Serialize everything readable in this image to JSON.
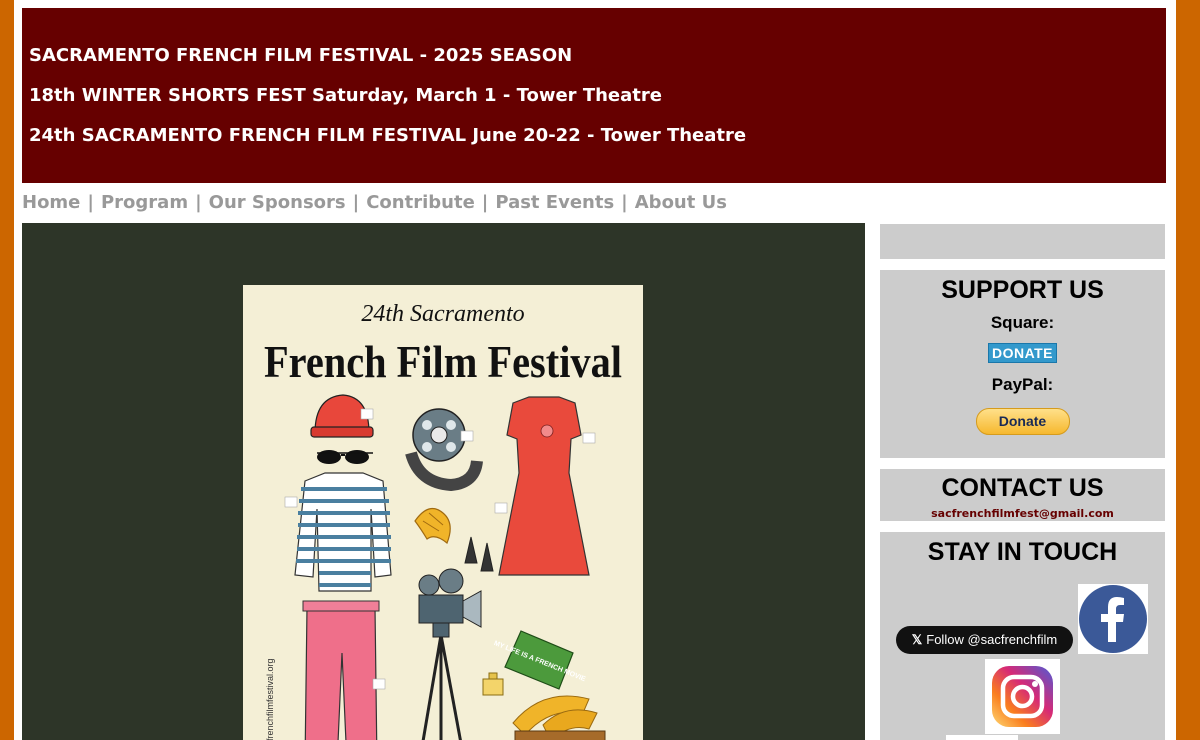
{
  "banner": {
    "line1": "SACRAMENTO FRENCH FILM FESTIVAL - 2025 SEASON",
    "line2": "18th WINTER SHORTS FEST Saturday, March 1 - Tower Theatre",
    "line3": "24th SACRAMENTO FRENCH FILM FESTIVAL June 20-22 - Tower Theatre"
  },
  "nav": {
    "items": [
      {
        "label": "Home"
      },
      {
        "label": "Program"
      },
      {
        "label": "Our Sponsors"
      },
      {
        "label": "Contribute"
      },
      {
        "label": "Past Events"
      },
      {
        "label": "About Us"
      }
    ],
    "separator": "|"
  },
  "poster": {
    "edition": "24th Sacramento",
    "title": "French Film Festival",
    "book_text": "MY LIFE IS A FRENCH MOVIE",
    "side_text": "sacfrenchfilmfestival.org"
  },
  "sidebar": {
    "support": {
      "title": "SUPPORT US",
      "square_label": "Square:",
      "square_button": "DONATE",
      "paypal_label": "PayPal:",
      "paypal_button": "Donate"
    },
    "contact": {
      "title": "CONTACT US",
      "email": "sacfrenchfilmfest@gmail.com"
    },
    "stay": {
      "title": "STAY IN TOUCH",
      "x_follow": "Follow @sacfrenchfilm"
    }
  },
  "colors": {
    "page_background": "#cc6600",
    "banner": "#660000",
    "nav_text": "#999999",
    "main_panel": "#2d3528",
    "sidebar": "#cccccc",
    "facebook": "#3b5998"
  }
}
